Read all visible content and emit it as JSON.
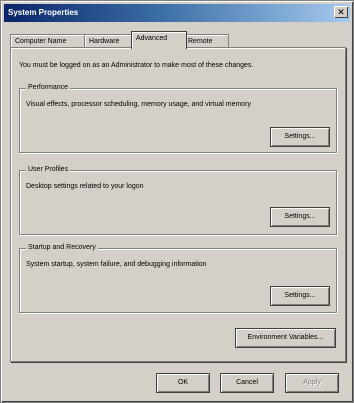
{
  "window": {
    "title": "System Properties",
    "close_glyph": "✕"
  },
  "tabs": [
    {
      "label": "Computer Name"
    },
    {
      "label": "Hardware"
    },
    {
      "label": "Advanced"
    },
    {
      "label": "Remote"
    }
  ],
  "active_tab": "Advanced",
  "intro_text": "You must be logged on as an Administrator to make most of these changes.",
  "groups": {
    "performance": {
      "title": "Performance",
      "description": "Visual effects, processor scheduling, memory usage, and virtual memory",
      "button": "Settings..."
    },
    "user_profiles": {
      "title": "User Profiles",
      "description": "Desktop settings related to your logon",
      "button": "Settings..."
    },
    "startup_recovery": {
      "title": "Startup and Recovery",
      "description": "System startup, system failure, and debugging information",
      "button": "Settings..."
    }
  },
  "env_button": "Environment Variables...",
  "footer": {
    "ok": "OK",
    "cancel": "Cancel",
    "apply": "Apply"
  }
}
